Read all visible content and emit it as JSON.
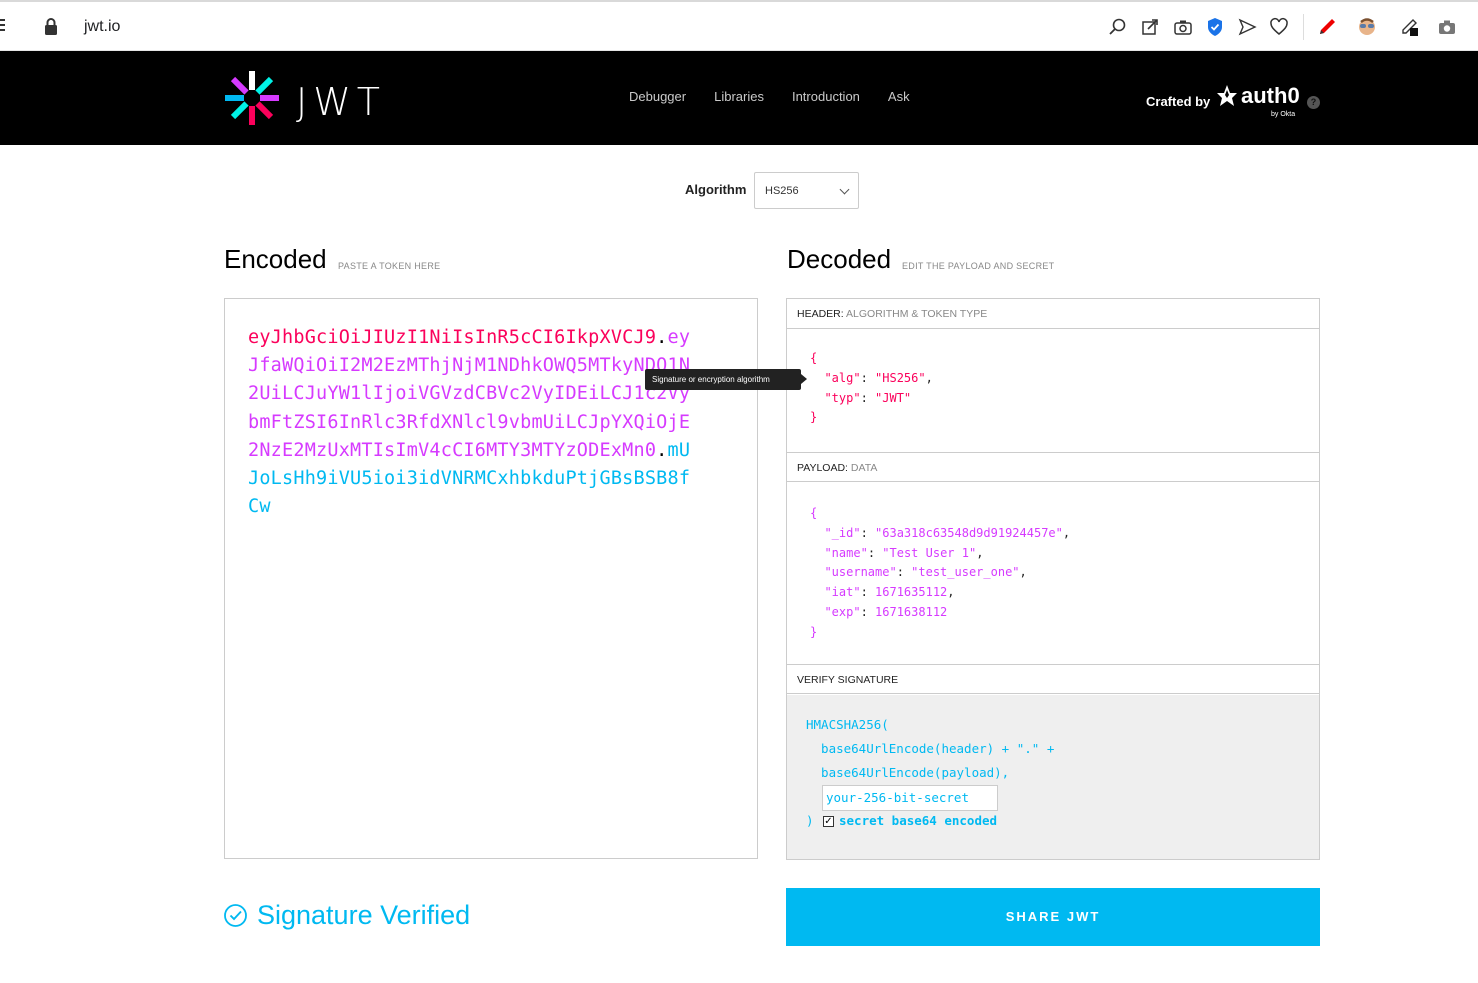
{
  "browser": {
    "url": "jwt.io",
    "extensions": [
      "search-zoom-icon",
      "share-edit-icon",
      "camera-icon",
      "shield-extension-icon",
      "send-icon",
      "heart-icon",
      "pen-red-icon",
      "avatar-extension-icon",
      "eyedropper-icon",
      "screenshot-icon"
    ]
  },
  "header": {
    "logo_text": "JWT",
    "nav": [
      "Debugger",
      "Libraries",
      "Introduction",
      "Ask"
    ],
    "crafted_by": "Crafted by",
    "brand": "auth0",
    "brand_sub": "by Okta",
    "help": "?"
  },
  "algorithm": {
    "label": "Algorithm",
    "selected": "HS256"
  },
  "encoded": {
    "title": "Encoded",
    "subtitle": "PASTE A TOKEN HERE",
    "token_header": "eyJhbGciOiJIUzI1NiIsInR5cCI6IkpXVCJ9",
    "token_payload": "eyJfaWQiOiI2M2EzMThjNjM1NDhkOWQ5MTkyNDQ1N2UiLCJuYW1lIjoiVGVzdCBVc2VyIDEiLCJ1c2VybmFtZSI6InRlc3RfdXNlcl9vbmUiLCJpYXQiOjE2NzE2MzUxMTIsImV4cCI6MTY3MTYzODExMn0",
    "token_signature": "mUJoLsHh9iVU5ioi3idVNRMCxhbkduPtjGBsBSB8fCw",
    "dot": "."
  },
  "tooltip": "Signature or encryption algorithm",
  "decoded": {
    "title": "Decoded",
    "subtitle": "EDIT THE PAYLOAD AND SECRET",
    "header_label": "HEADER:",
    "header_label_sub": "ALGORITHM & TOKEN TYPE",
    "header_json": {
      "open": "{",
      "alg_key": "\"alg\"",
      "alg_val": "\"HS256\"",
      "typ_key": "\"typ\"",
      "typ_val": "\"JWT\"",
      "close": "}"
    },
    "payload_label": "PAYLOAD:",
    "payload_label_sub": "DATA",
    "payload_json": {
      "open": "{",
      "id_key": "\"_id\"",
      "id_val": "\"63a318c63548d9d91924457e\"",
      "name_key": "\"name\"",
      "name_val": "\"Test User 1\"",
      "username_key": "\"username\"",
      "username_val": "\"test_user_one\"",
      "iat_key": "\"iat\"",
      "iat_val": "1671635112",
      "exp_key": "\"exp\"",
      "exp_val": "1671638112",
      "close": "}"
    },
    "verify_label": "VERIFY SIGNATURE",
    "verify_fn": "HMACSHA256(",
    "verify_line1": "  base64UrlEncode(header) + \".\" +",
    "verify_line2": "  base64UrlEncode(payload),",
    "secret_value": "your-256-bit-secret",
    "close_paren": ")",
    "base64_checkbox_label": "secret base64 encoded",
    "base64_checked": true
  },
  "status": {
    "verified_text": "Signature Verified"
  },
  "share_button": "SHARE JWT",
  "colors": {
    "header_part": "#fb015b",
    "payload_part": "#d63aff",
    "signature_part": "#00b9f1"
  }
}
